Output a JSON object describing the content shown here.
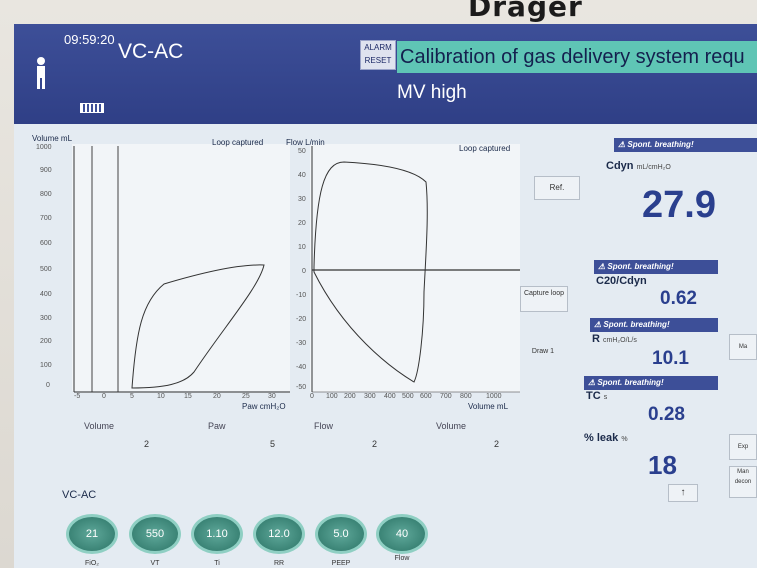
{
  "brand": "Dräger",
  "header": {
    "time": "09:59:20",
    "mode": "VC-AC",
    "alarm_reset_label": "ALARM RESET",
    "alarm_message": "Calibration of gas delivery system requ",
    "alarm_sub": "MV high",
    "colors": {
      "header": "#3d4f98",
      "alarm": "#5fc5b5"
    }
  },
  "volume_loop": {
    "y_label": "Volume mL",
    "status": "Loop captured",
    "x_label": "Paw cmH₂O",
    "y_ticks": [
      "1000",
      "900",
      "800",
      "700",
      "600",
      "500",
      "400",
      "300",
      "200",
      "100",
      "0"
    ],
    "x_ticks": [
      "-5",
      "0",
      "5",
      "10",
      "15",
      "20",
      "25",
      "30"
    ]
  },
  "flow_loop": {
    "y_label": "Flow L/min",
    "status": "Loop captured",
    "x_label": "Volume mL",
    "y_ticks": [
      "50",
      "40",
      "30",
      "20",
      "10",
      "0",
      "-10",
      "-20",
      "-30",
      "-40",
      "-50"
    ],
    "x_ticks": [
      "0",
      "100",
      "200",
      "300",
      "400",
      "500",
      "600",
      "700",
      "800",
      "1000"
    ]
  },
  "plot_buttons": {
    "ref": "Ref.",
    "capture": "Capture loop",
    "draw": "Draw 1"
  },
  "tiles": [
    {
      "name": "Volume",
      "value": "2"
    },
    {
      "name": "Paw",
      "value": "5"
    },
    {
      "name": "Flow",
      "value": "2"
    },
    {
      "name": "Volume",
      "value": "2"
    }
  ],
  "bottom_mode": "VC-AC",
  "knobs": [
    {
      "value": "21",
      "label": "FiO₂"
    },
    {
      "value": "550",
      "label": "VT"
    },
    {
      "value": "1.10",
      "label": "Ti"
    },
    {
      "value": "12.0",
      "label": "RR"
    },
    {
      "value": "5.0",
      "label": "PEEP"
    },
    {
      "value": "40",
      "label": "Flow"
    }
  ],
  "params": [
    {
      "head": "⚠ Spont. breathing!",
      "name": "Cdyn",
      "unit": "mL/cmH₂O",
      "value": "27.9"
    },
    {
      "head": "⚠ Spont. breathing!",
      "name": "C20/Cdyn",
      "unit": "",
      "value": "0.62"
    },
    {
      "head": "⚠ Spont. breathing!",
      "name": "R",
      "unit": "cmH₂O/L/s",
      "value": "10.1"
    },
    {
      "head": "⚠ Spont. breathing!",
      "name": "TC",
      "unit": "s",
      "value": "0.28"
    },
    {
      "head": "",
      "name": "% leak",
      "unit": "%",
      "value": "18"
    }
  ],
  "up_arrow": "↑",
  "edge_buttons": [
    "Ma",
    "Exp",
    "Man decon"
  ]
}
